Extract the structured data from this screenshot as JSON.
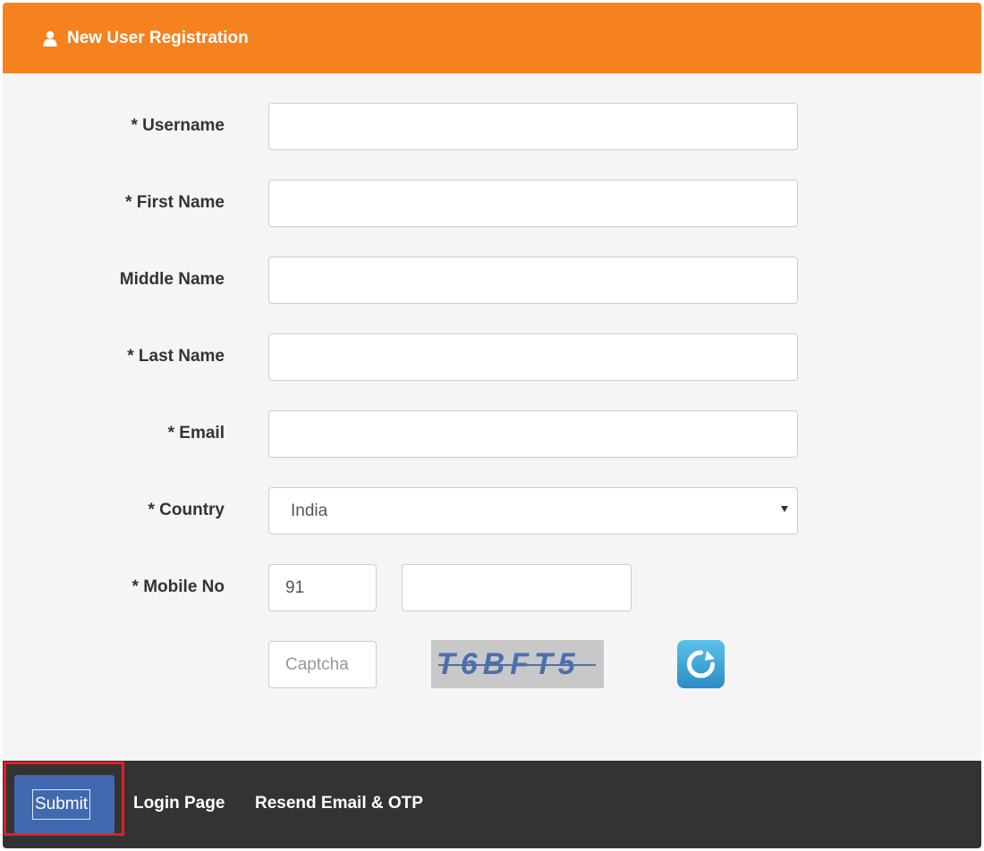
{
  "header": {
    "icon": "user-icon",
    "title": "New User Registration",
    "color": "#f5821f"
  },
  "form": {
    "username_label": "* Username",
    "username_value": "",
    "first_name_label": "* First Name",
    "first_name_value": "",
    "middle_name_label": "Middle Name",
    "middle_name_value": "",
    "last_name_label": "* Last Name",
    "last_name_value": "",
    "email_label": "* Email",
    "email_value": "",
    "country_label": "* Country",
    "country_value": "India",
    "mobile_label": "* Mobile No",
    "mobile_code_value": "91",
    "mobile_number_value": "",
    "captcha_placeholder": "Captcha",
    "captcha_text": "T6BFT5",
    "refresh_icon": "refresh-icon"
  },
  "footer": {
    "submit_label": "Submit",
    "login_link": "Login Page",
    "resend_link": "Resend Email & OTP",
    "highlight_color": "#e31e24"
  }
}
